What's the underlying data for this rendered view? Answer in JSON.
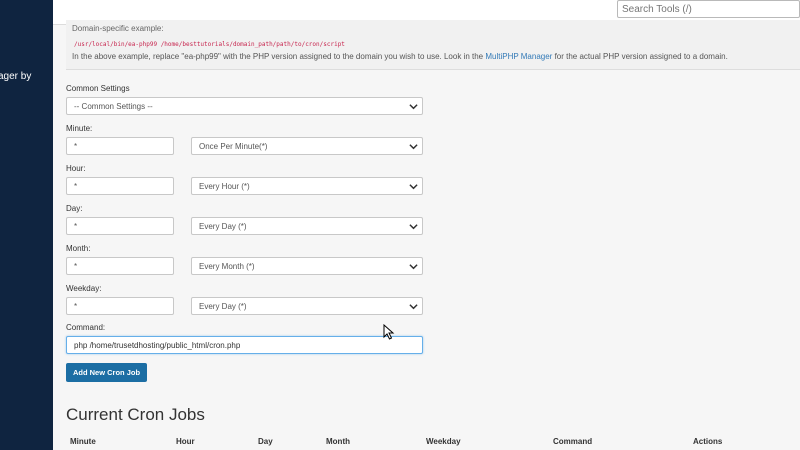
{
  "sidebar": {
    "partial_text": "ager by"
  },
  "topbar": {
    "search_placeholder": "Search Tools (/)"
  },
  "info": {
    "heading": "Domain-specific example:",
    "code": "/usr/local/bin/ea-php99 /home/besttutorials/domain_path/path/to/cron/script",
    "desc_before": "In the above example, replace \"ea-php99\" with the PHP version assigned to the domain you wish to use. Look in the ",
    "desc_link": "MultiPHP Manager",
    "desc_after": " for the actual PHP version assigned to a domain."
  },
  "form": {
    "common_settings": {
      "label": "Common Settings",
      "value": "-- Common Settings --"
    },
    "minute": {
      "label": "Minute:",
      "value": "*",
      "select": "Once Per Minute(*)"
    },
    "hour": {
      "label": "Hour:",
      "value": "*",
      "select": "Every Hour (*)"
    },
    "day": {
      "label": "Day:",
      "value": "*",
      "select": "Every Day (*)"
    },
    "month": {
      "label": "Month:",
      "value": "*",
      "select": "Every Month (*)"
    },
    "weekday": {
      "label": "Weekday:",
      "value": "*",
      "select": "Every Day (*)"
    },
    "command": {
      "label": "Command:",
      "value": "php /home/trusetdhosting/public_html/cron.php"
    },
    "submit_label": "Add New Cron Job"
  },
  "jobs": {
    "title": "Current Cron Jobs",
    "columns": [
      "Minute",
      "Hour",
      "Day",
      "Month",
      "Weekday",
      "Command",
      "Actions"
    ]
  }
}
